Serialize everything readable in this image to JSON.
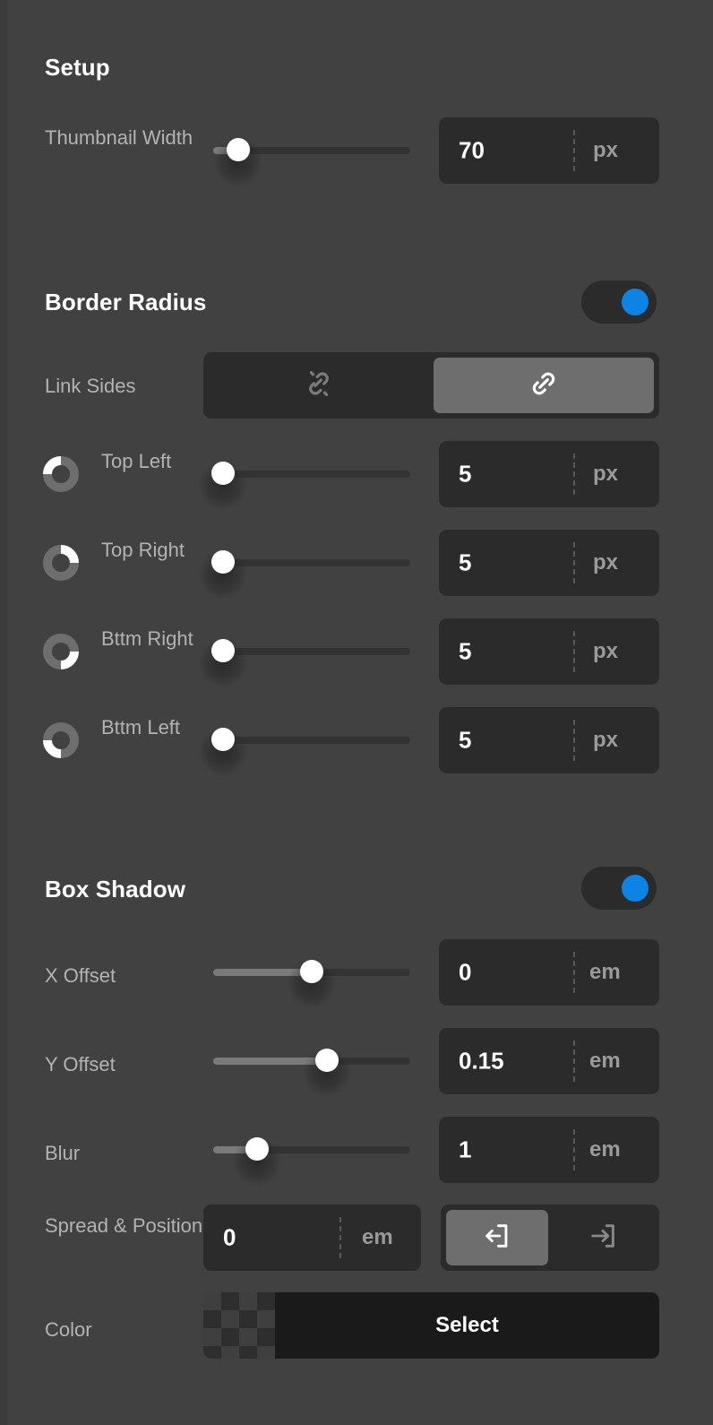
{
  "theme": {
    "background": "#414141",
    "panel_field_bg": "#2b2b2b",
    "accent_blue": "#0b84e6",
    "label_gray": "#b3b3b3",
    "selected_seg": "#6e6e6e",
    "slider_track": "#333333",
    "slider_fill": "#7a7a7a",
    "color_swatch": "#1a1a1a"
  },
  "sections": {
    "setup": {
      "title": "Setup",
      "rows": [
        {
          "label": "Thumbnail Width",
          "slider": {
            "percent": 13,
            "filled": false
          },
          "value": "70",
          "unit": "px"
        }
      ]
    },
    "border_radius": {
      "title": "Border Radius",
      "enabled": true,
      "link_sides": {
        "label": "Link Sides",
        "options": [
          {
            "icon": "broken-link-icon",
            "selected": false
          },
          {
            "icon": "link-icon",
            "selected": true
          }
        ]
      },
      "corners": [
        {
          "label": "Top Left",
          "icon": "corner-top-left-icon",
          "slider": {
            "percent": 5,
            "filled": false
          },
          "value": "5",
          "unit": "px"
        },
        {
          "label": "Top Right",
          "icon": "corner-top-right-icon",
          "slider": {
            "percent": 5,
            "filled": false
          },
          "value": "5",
          "unit": "px"
        },
        {
          "label": "Bttm Right",
          "icon": "corner-bottom-right-icon",
          "slider": {
            "percent": 5,
            "filled": false
          },
          "value": "5",
          "unit": "px"
        },
        {
          "label": "Bttm Left",
          "icon": "corner-bottom-left-icon",
          "slider": {
            "percent": 5,
            "filled": false
          },
          "value": "5",
          "unit": "px"
        }
      ]
    },
    "box_shadow": {
      "title": "Box Shadow",
      "enabled": true,
      "rows": [
        {
          "label": "X Offset",
          "slider": {
            "percent": 50,
            "filled": true
          },
          "value": "0",
          "unit": "em"
        },
        {
          "label": "Y Offset",
          "slider": {
            "percent": 58,
            "filled": true
          },
          "value": "0.15",
          "unit": "em"
        },
        {
          "label": "Blur",
          "slider": {
            "percent": 22,
            "filled": true
          },
          "value": "1",
          "unit": "em"
        }
      ],
      "spread": {
        "label": "Spread & Position",
        "value": "0",
        "unit": "em",
        "position_options": [
          {
            "icon": "shadow-outset-icon",
            "selected": true
          },
          {
            "icon": "shadow-inset-icon",
            "selected": false
          }
        ]
      },
      "color": {
        "label": "Color",
        "button_label": "Select",
        "swatch_color": "#1a1a1a"
      }
    }
  }
}
